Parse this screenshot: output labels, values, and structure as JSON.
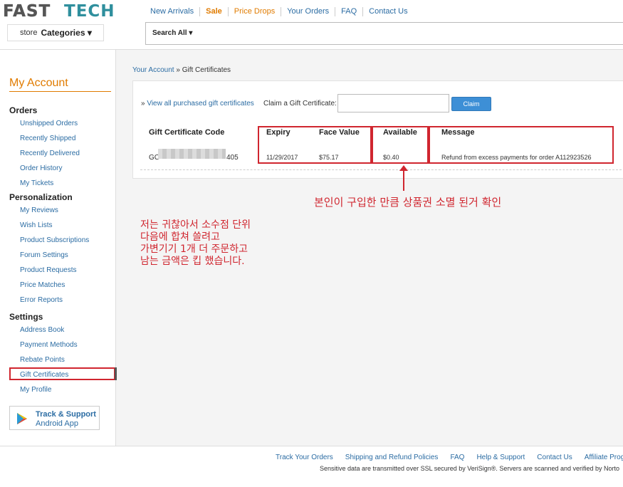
{
  "header": {
    "logo_text": "FASTTECH",
    "nav": [
      {
        "label": "New Arrivals",
        "style": "link"
      },
      {
        "label": "Sale",
        "style": "sale"
      },
      {
        "label": "Price Drops",
        "style": "drops"
      },
      {
        "label": "Your Orders",
        "style": "link"
      },
      {
        "label": "FAQ",
        "style": "link"
      },
      {
        "label": "Contact Us",
        "style": "link"
      }
    ],
    "store_label": "store",
    "categories_label": "Categories ▾",
    "search_scope": "Search All ▾"
  },
  "sidebar": {
    "title": "My Account",
    "sections": [
      {
        "heading": "Orders",
        "items": [
          "Unshipped Orders",
          "Recently Shipped",
          "Recently Delivered",
          "Order History",
          "My Tickets"
        ]
      },
      {
        "heading": "Personalization",
        "items": [
          "My Reviews",
          "Wish Lists",
          "Product Subscriptions",
          "Forum Settings",
          "Product Requests",
          "Price Matches",
          "Error Reports"
        ]
      },
      {
        "heading": "Settings",
        "items": [
          "Address Book",
          "Payment Methods",
          "Rebate Points",
          "Gift Certificates",
          "My Profile"
        ]
      }
    ],
    "active_item": "Gift Certificates",
    "app_line1": "Track & Support",
    "app_line2": "Android App"
  },
  "main": {
    "breadcrumb_link": "Your Account",
    "breadcrumb_sep": " » ",
    "breadcrumb_current": "Gift Certificates",
    "view_all_prefix": "» ",
    "view_all": "View all purchased gift certificates",
    "claim_label": "Claim a Gift Certificate:",
    "claim_input_value": "",
    "claim_button": "Claim",
    "table": {
      "headers": [
        "Gift Certificate Code",
        "Expiry",
        "Face Value",
        "Available",
        "Message"
      ],
      "row": {
        "code_prefix": "GC",
        "code_suffix": "405",
        "expiry": "11/29/2017",
        "face_value": "$75.17",
        "available": "$0.40",
        "message": "Refund from excess payments for order A112923526"
      }
    }
  },
  "annotations": {
    "note1": "본인이 구입한 만큼 상품권 소멸 된거 확인",
    "note2": [
      "저는 귀찮아서 소수점 단위",
      "다음에 합쳐 쓸려고",
      "가변기기 1개 더 주문하고",
      "남는 금액은 킵 했습니다."
    ],
    "highlight_color": "#d0262f"
  },
  "footer": {
    "links": [
      "Track Your Orders",
      "Shipping and Refund Policies",
      "FAQ",
      "Help & Support",
      "Contact Us",
      "Affiliate Program"
    ],
    "note": "Sensitive data are transmitted over SSL secured by VeriSign®. Servers are scanned and verified by Norto"
  },
  "colors": {
    "accent_orange": "#e07b00",
    "link_blue": "#2b6ca3",
    "claim_blue": "#3d8fd6",
    "annotation_red": "#d0262f",
    "logo_teal": "#2f8f9d"
  }
}
